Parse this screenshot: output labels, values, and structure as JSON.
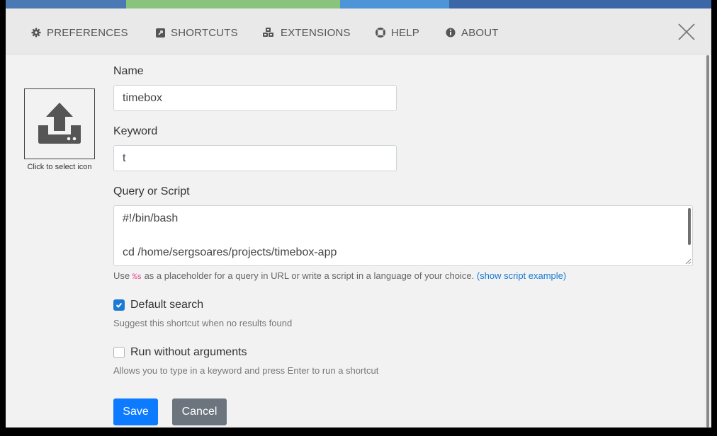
{
  "colors": {
    "strip": [
      "#4a79b4",
      "#8ac47c",
      "#4e95d8",
      "#3b67a8"
    ],
    "accent": "#0d7bff",
    "secondary": "#6c757d",
    "link": "#1a7ad4"
  },
  "nav": {
    "items": [
      {
        "label": "PREFERENCES",
        "icon": "gear-icon"
      },
      {
        "label": "SHORTCUTS",
        "icon": "external-link-icon"
      },
      {
        "label": "EXTENSIONS",
        "icon": "cubes-icon"
      },
      {
        "label": "HELP",
        "icon": "life-ring-icon"
      },
      {
        "label": "ABOUT",
        "icon": "info-circle-icon"
      }
    ],
    "close_icon": "close-icon"
  },
  "icon_picker": {
    "icon": "upload-icon",
    "caption": "Click to select icon"
  },
  "form": {
    "name_label": "Name",
    "name_value": "timebox",
    "keyword_label": "Keyword",
    "keyword_value": "t",
    "query_label": "Query or Script",
    "query_lines": [
      "#!/bin/bash",
      "",
      "cd /home/sergsoares/projects/timebox-app"
    ],
    "help_prefix": "Use",
    "help_code": "%s",
    "help_suffix": "as a placeholder for a query in URL or write a script in a language of your choice.",
    "help_link": "(show script example)",
    "default_search_label": "Default search",
    "default_search_checked": true,
    "default_search_help": "Suggest this shortcut when no results found",
    "run_without_args_label": "Run without arguments",
    "run_without_args_checked": false,
    "run_without_args_help": "Allows you to type in a keyword and press Enter to run a shortcut",
    "save_label": "Save",
    "cancel_label": "Cancel"
  }
}
